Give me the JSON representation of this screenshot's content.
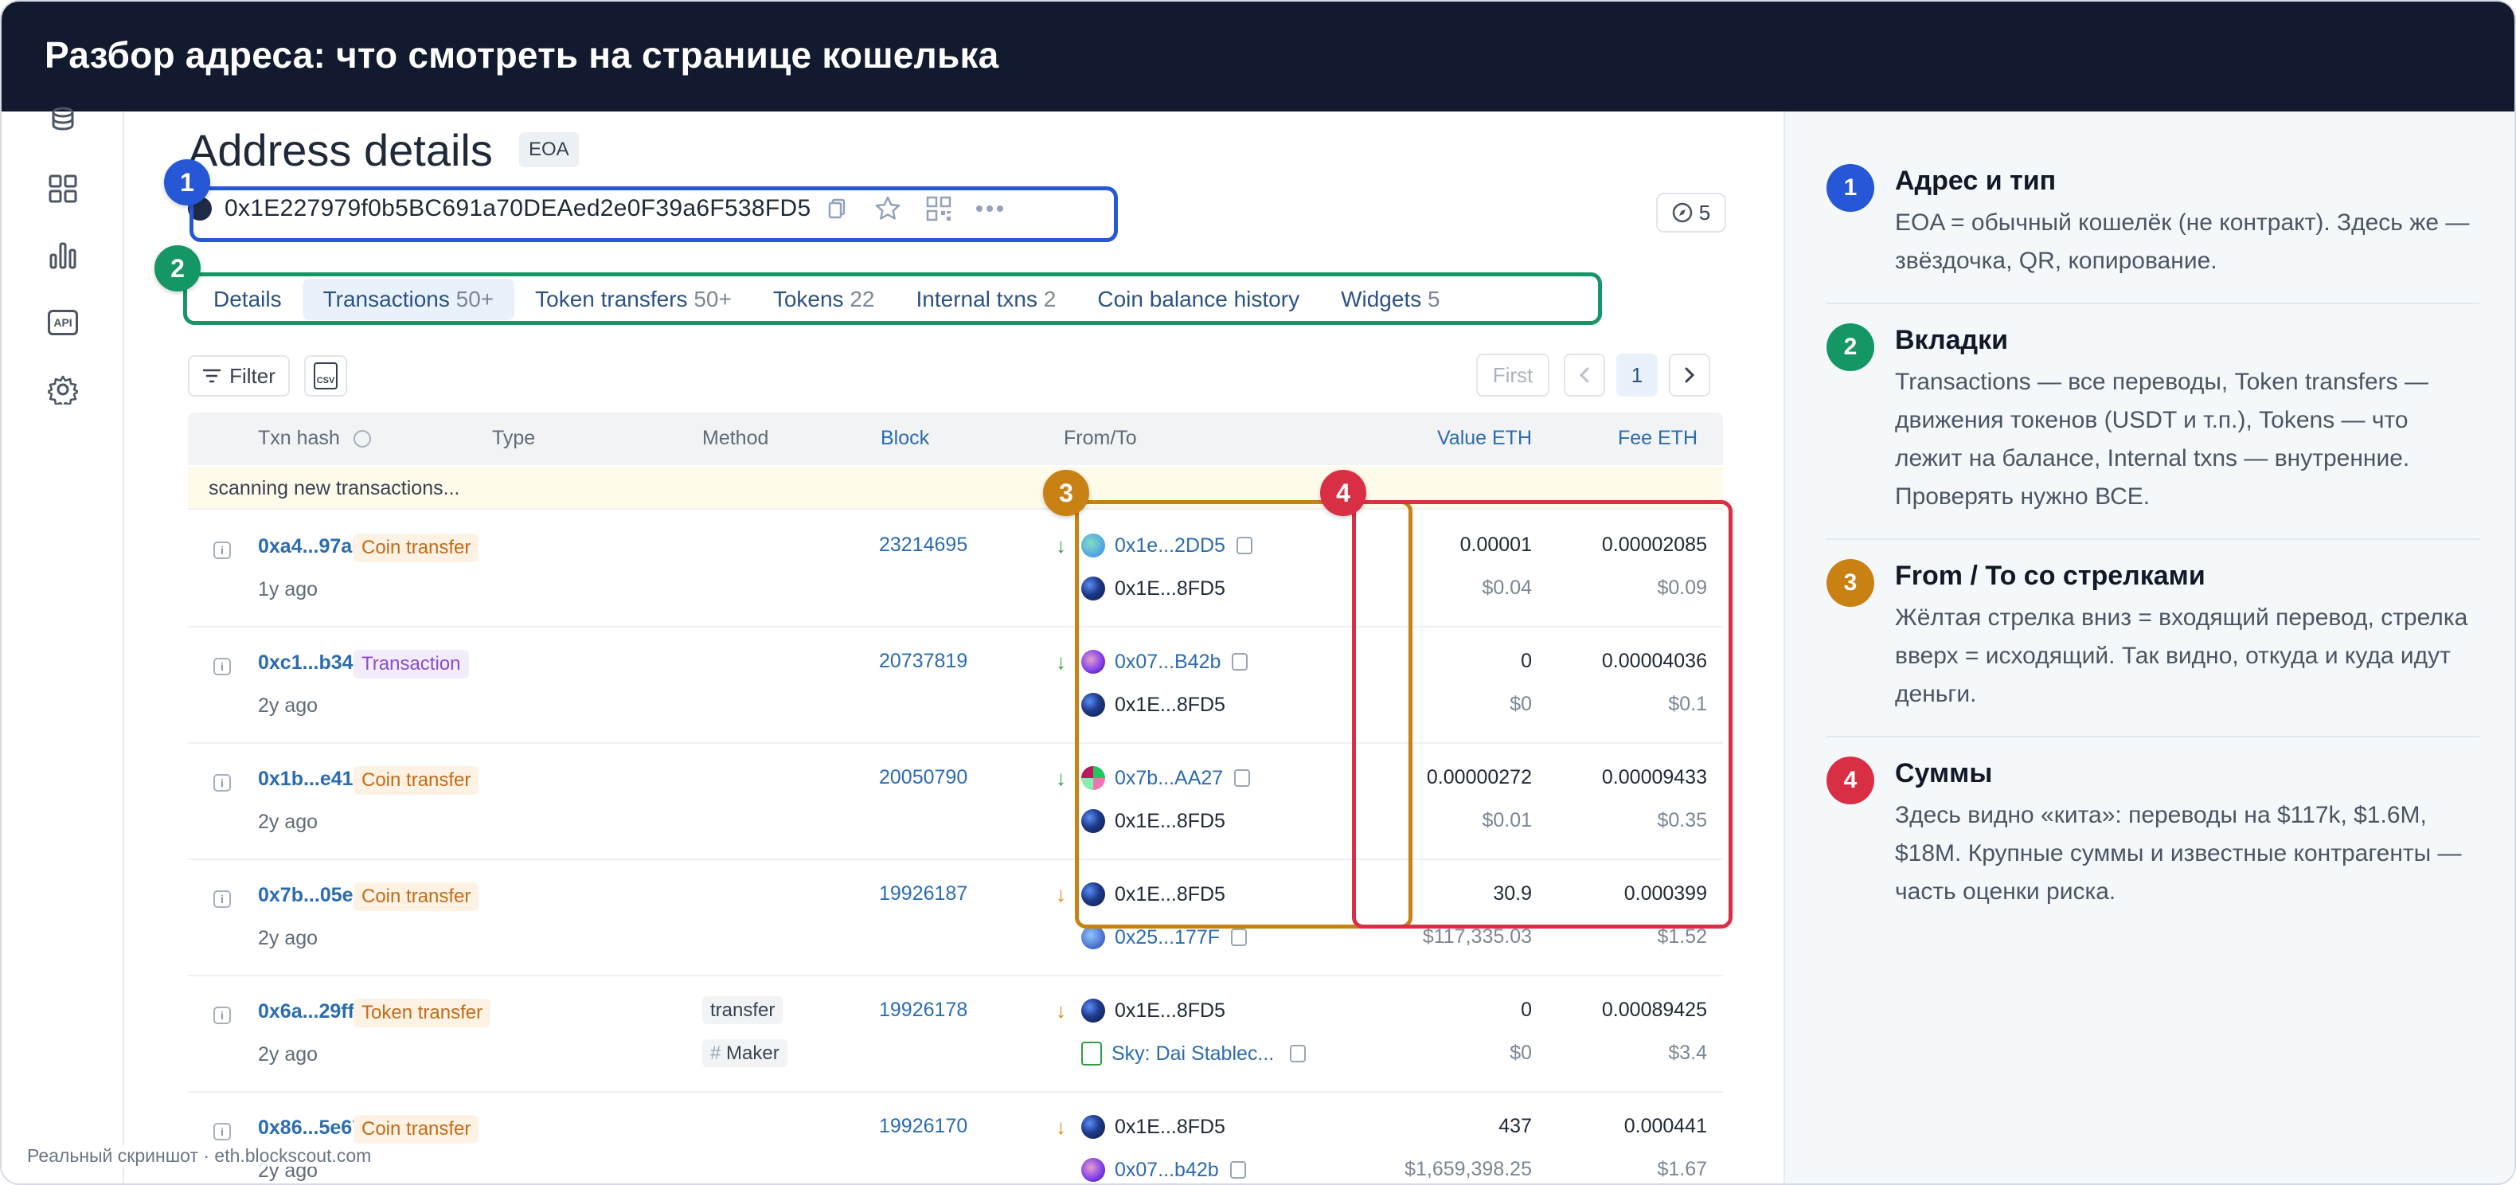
{
  "header": {
    "title": "Разбор адреса: что смотреть на странице кошелька"
  },
  "rail": {
    "icons": [
      "coins-icon",
      "grid-icon",
      "bar-chart-icon",
      "api-icon",
      "gear-icon"
    ],
    "api_label": "API"
  },
  "page": {
    "title": "Address details",
    "badge": "EOA",
    "address": "0x1E227979f0b5BC691a70DEAed2e0F39a6F538FD5",
    "counter": "5"
  },
  "tabs": [
    {
      "label": "Details",
      "count": ""
    },
    {
      "label": "Transactions",
      "count": "50+"
    },
    {
      "label": "Token transfers",
      "count": "50+"
    },
    {
      "label": "Tokens",
      "count": "22"
    },
    {
      "label": "Internal txns",
      "count": "2"
    },
    {
      "label": "Coin balance history",
      "count": ""
    },
    {
      "label": "Widgets",
      "count": "5"
    }
  ],
  "toolbar": {
    "filter": "Filter",
    "csv": "CSV",
    "first": "First",
    "page": "1"
  },
  "table": {
    "headers": {
      "hash": "Txn hash",
      "type": "Type",
      "method": "Method",
      "block": "Block",
      "fromto": "From/To",
      "value": "Value ETH",
      "fee": "Fee ETH"
    },
    "scanning": "scanning new transactions...",
    "rows": [
      {
        "hash": "0xa4...97ab",
        "ago": "1y ago",
        "type": "Coin transfer",
        "method": "",
        "method2": "",
        "block": "23214695",
        "from": "0x1e...2DD5",
        "to": "0x1E...8FD5",
        "value": "0.00001",
        "value_usd": "$0.04",
        "fee": "0.00002085",
        "fee_usd": "$0.09"
      },
      {
        "hash": "0xc1...b34f",
        "ago": "2y ago",
        "type": "Transaction",
        "method": "",
        "method2": "",
        "block": "20737819",
        "from": "0x07...B42b",
        "to": "0x1E...8FD5",
        "value": "0",
        "value_usd": "$0",
        "fee": "0.00004036",
        "fee_usd": "$0.1"
      },
      {
        "hash": "0x1b...e41e",
        "ago": "2y ago",
        "type": "Coin transfer",
        "method": "",
        "method2": "",
        "block": "20050790",
        "from": "0x7b...AA27",
        "to": "0x1E...8FD5",
        "value": "0.00000272",
        "value_usd": "$0.01",
        "fee": "0.00009433",
        "fee_usd": "$0.35"
      },
      {
        "hash": "0x7b...05ea",
        "ago": "2y ago",
        "type": "Coin transfer",
        "method": "",
        "method2": "",
        "block": "19926187",
        "from": "0x1E...8FD5",
        "to": "0x25...177F",
        "value": "30.9",
        "value_usd": "$117,335.03",
        "fee": "0.000399",
        "fee_usd": "$1.52"
      },
      {
        "hash": "0x6a...29ff",
        "ago": "2y ago",
        "type": "Token transfer",
        "method": "transfer",
        "method2": "Maker",
        "block": "19926178",
        "from": "0x1E...8FD5",
        "to": "Sky: Dai Stablec...",
        "value": "0",
        "value_usd": "$0",
        "fee": "0.00089425",
        "fee_usd": "$3.4"
      },
      {
        "hash": "0x86...5e67",
        "ago": "2y ago",
        "type": "Coin transfer",
        "method": "",
        "method2": "",
        "block": "19926170",
        "from": "0x1E...8FD5",
        "to": "0x07...b42b",
        "value": "437",
        "value_usd": "$1,659,398.25",
        "fee": "0.000441",
        "fee_usd": "$1.67"
      }
    ]
  },
  "footnote": "Реальный скриншот · eth.blockscout.com",
  "notes": [
    {
      "num": "1",
      "title": "Адрес и тип",
      "text": "EOA = обычный кошелёк (не контракт). Здесь же — звёздочка, QR, копирование."
    },
    {
      "num": "2",
      "title": "Вкладки",
      "text": "Transactions — все переводы, Token transfers — движения токенов (USDT и т.п.), Tokens — что лежит на балансе, Internal txns — внутренние. Проверять нужно ВСЕ."
    },
    {
      "num": "3",
      "title": "From / To со стрелками",
      "text": "Жёлтая стрелка вниз = входящий перевод, стрелка вверх = исходящий. Так видно, откуда и куда идут деньги."
    },
    {
      "num": "4",
      "title": "Суммы",
      "text": "Здесь видно «кита»: переводы на $117k, $1.6M, $18M. Крупные суммы и известные контрагенты — часть оценки риска."
    }
  ],
  "colors": {
    "blue": "#2557d6",
    "green": "#149764",
    "amber": "#c98113",
    "red": "#d92f45",
    "header_bg": "#111a2e"
  }
}
